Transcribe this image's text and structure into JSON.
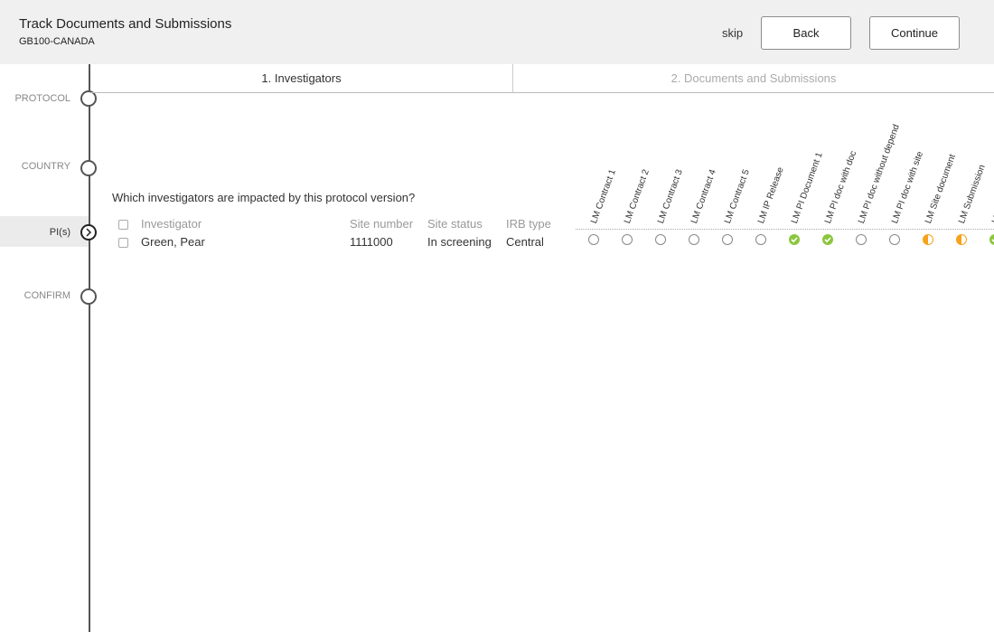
{
  "header": {
    "title": "Track Documents and Submissions",
    "subtitle": "GB100-CANADA",
    "skip_label": "skip",
    "back_label": "Back",
    "continue_label": "Continue"
  },
  "steps": [
    {
      "label": "PROTOCOL"
    },
    {
      "label": "COUNTRY"
    },
    {
      "label": "PI(s)",
      "active": true
    },
    {
      "label": "CONFIRM"
    }
  ],
  "tabs": [
    {
      "label": "1. Investigators",
      "active": true
    },
    {
      "label": "2. Documents and Submissions",
      "active": false
    }
  ],
  "question": "Which investigators are impacted by this protocol version?",
  "table": {
    "headers": {
      "investigator": "Investigator",
      "site_number": "Site number",
      "site_status": "Site status",
      "irb_type": "IRB type"
    },
    "rows": [
      {
        "investigator": "Green, Pear",
        "site_number": "1111000",
        "site_status": "In screening",
        "irb_type": "Central"
      }
    ]
  },
  "documents": [
    {
      "label": "LM Contract 1",
      "status": "empty"
    },
    {
      "label": "LM Contract 2",
      "status": "empty"
    },
    {
      "label": "LM Contract 3",
      "status": "empty"
    },
    {
      "label": "LM Contract 4",
      "status": "empty"
    },
    {
      "label": "LM Contract 5",
      "status": "empty"
    },
    {
      "label": "LM IP Release",
      "status": "empty"
    },
    {
      "label": "LM PI Document 1",
      "status": "done"
    },
    {
      "label": "LM PI doc with doc",
      "status": "done"
    },
    {
      "label": "LM PI doc without depend",
      "status": "empty"
    },
    {
      "label": "LM PI doc with site",
      "status": "empty"
    },
    {
      "label": "LM Site document",
      "status": "partial"
    },
    {
      "label": "LM Submission",
      "status": "partial"
    },
    {
      "label": "LM",
      "status": "done"
    }
  ],
  "colors": {
    "done": "#8cc63f",
    "partial": "#f7a21b",
    "empty": "#888888"
  }
}
